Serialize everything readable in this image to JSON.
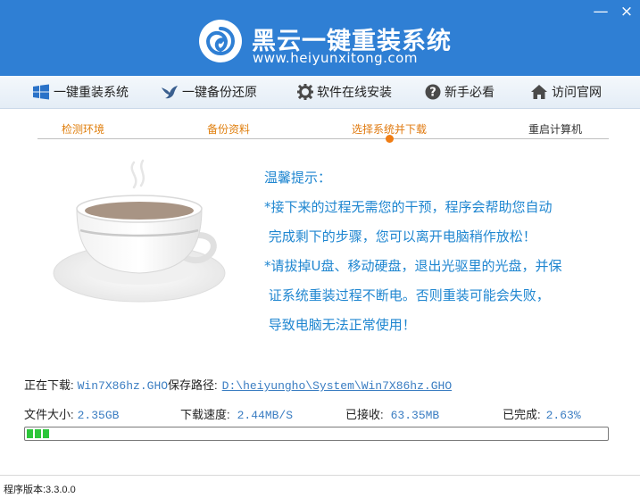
{
  "app": {
    "title": "黑云一键重装系统",
    "subtitle": "www.heiyunxitong.com",
    "logo_icon": "swirl-logo-icon"
  },
  "window": {
    "minimize_label": "—",
    "close_label": "×"
  },
  "nav": {
    "items": [
      {
        "label": "一键重装系统",
        "icon": "windows-icon"
      },
      {
        "label": "一键备份还原",
        "icon": "bird-icon"
      },
      {
        "label": "软件在线安装",
        "icon": "gear-icon"
      },
      {
        "label": "新手必看",
        "icon": "question-icon"
      },
      {
        "label": "访问官网",
        "icon": "home-icon"
      }
    ]
  },
  "steps": {
    "items": [
      {
        "label": "检测环境",
        "state": "done"
      },
      {
        "label": "备份资料",
        "state": "done"
      },
      {
        "label": "选择系统并下载",
        "state": "active"
      },
      {
        "label": "重启计算机",
        "state": "pending"
      }
    ],
    "active_color": "#f07d14",
    "done_color": "#e08010"
  },
  "tips": {
    "heading": "温馨提示：",
    "lines": [
      "*接下来的过程无需您的干预，程序会帮助您自动",
      " 完成剩下的步骤，您可以离开电脑稍作放松！",
      "*请拔掉U盘、移动硬盘，退出光驱里的光盘，并保",
      " 证系统重装过程不断电。否则重装可能会失败，",
      " 导致电脑无法正常使用！"
    ],
    "color": "#1f86d0"
  },
  "download": {
    "downloading_label": "正在下载:",
    "file_name": "Win7X86hz.GHO",
    "save_path_label": "保存路径:",
    "save_path": "D:\\heiyungho\\System\\Win7X86hz.GHO",
    "size_label": "文件大小:",
    "size": "2.35GB",
    "speed_label": "下载速度:",
    "speed": "2.44MB/S",
    "received_label": "已接收:",
    "received": "63.35MB",
    "completed_label": "已完成:",
    "completed": "2.63%",
    "progress": 0.0263
  },
  "footer": {
    "version": "程序版本:3.3.0.0"
  },
  "colors": {
    "header": "#2f7fd4",
    "progress": "#2cc63a"
  }
}
